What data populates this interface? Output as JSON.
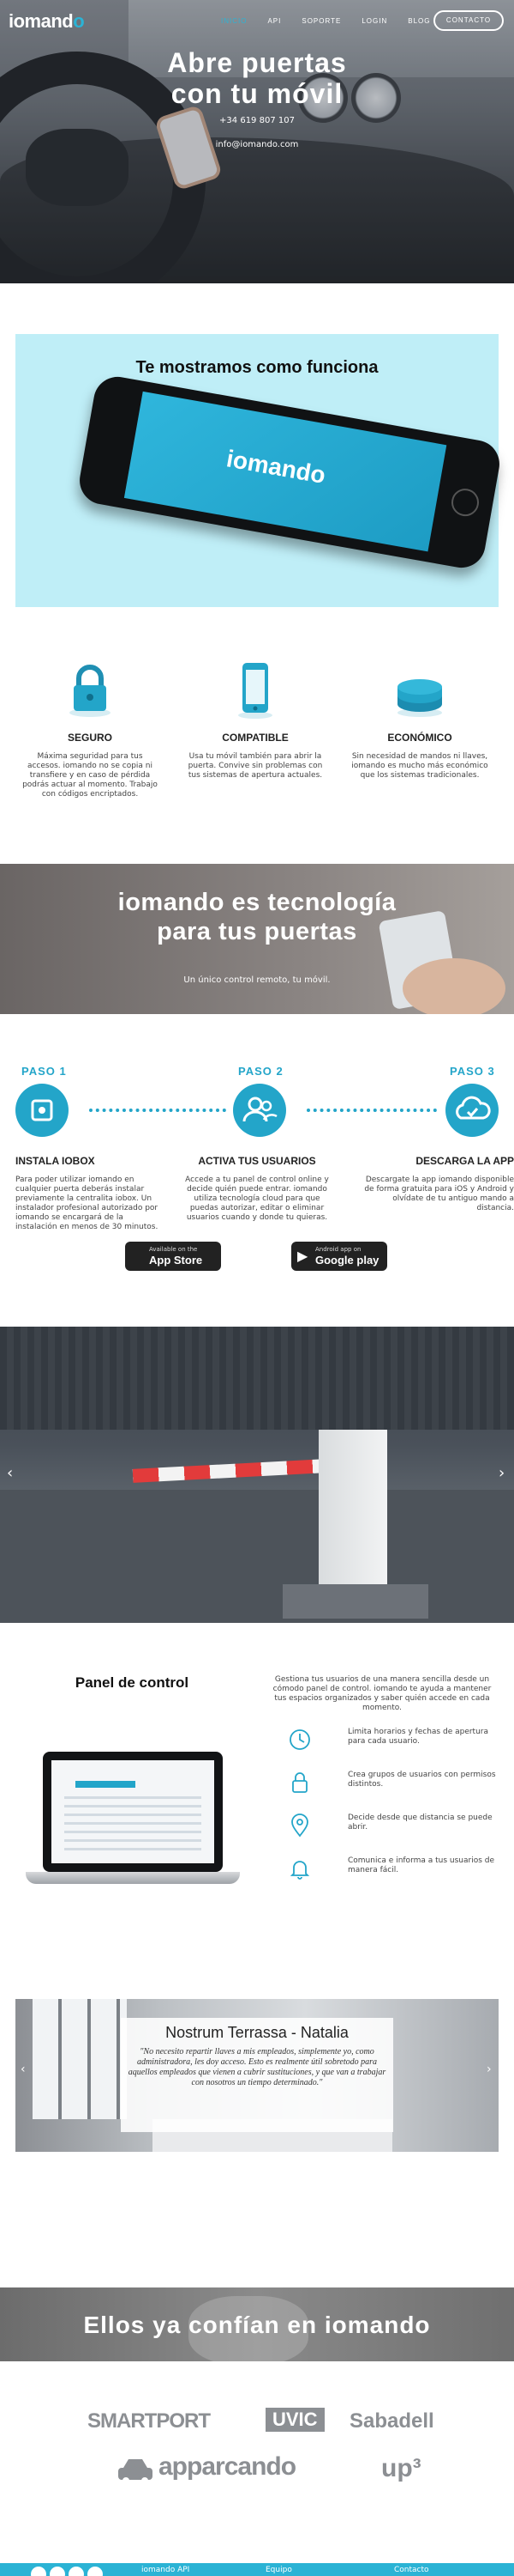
{
  "header": {
    "logo_text": "iomand",
    "logo_accent": "o",
    "nav": [
      "INICIO",
      "API",
      "SOPORTE",
      "LOGIN",
      "BLOG"
    ],
    "contact_button": "CONTACTO"
  },
  "hero": {
    "title_line1": "Abre puertas",
    "title_line2": "con tu móvil",
    "phone": "+34 619 807 107",
    "email": "info@iomando.com"
  },
  "demo": {
    "title": "Te mostramos como funciona",
    "screen_logo": "iomando"
  },
  "features": [
    {
      "title": "SEGURO",
      "text": "Máxima seguridad para tus accesos. iomando no se copia ni transfiere y en caso de pérdida podrás actuar al momento. Trabajo con códigos encriptados.",
      "icon": "padlock-icon"
    },
    {
      "title": "COMPATIBLE",
      "text": "Usa tu móvil también para abrir la puerta. Convive sin problemas con tus sistemas de apertura actuales.",
      "icon": "smartphone-icon"
    },
    {
      "title": "ECONÓMICO",
      "text": "Sin necesidad de mandos ni llaves, iomando es mucho más económico que los sistemas tradicionales.",
      "icon": "coins-icon"
    }
  ],
  "tech": {
    "title_line1": "iomando es tecnología",
    "title_line2": "para tus puertas",
    "subtitle": "Un único control remoto, tu móvil."
  },
  "steps": [
    {
      "label": "PASO 1",
      "title": "INSTALA IOBOX",
      "text": "Para poder utilizar iomando en cualquier puerta deberás instalar previamente la centralita iobox. Un instalador profesional autorizado por iomando se encargará de la instalación en menos de 30 minutos.",
      "icon": "box-icon"
    },
    {
      "label": "PASO 2",
      "title": "ACTIVA TUS USUARIOS",
      "text": "Accede a tu panel de control online y decide quién puede entrar. iomando utiliza tecnología cloud para que puedas autorizar, editar o eliminar usuarios cuando y donde tu quieras.",
      "icon": "users-icon"
    },
    {
      "label": "PASO 3",
      "title": "DESCARGA LA APP",
      "text": "Descargate la app iomando disponible de forma gratuita para iOS y Android y olvídate de tu antiguo mando a distancia.",
      "icon": "cloud-icon"
    }
  ],
  "stores": {
    "apple_small": "Available on the",
    "apple_big": "App Store",
    "google_small": "Android app on",
    "google_big": "Google play"
  },
  "control_panel": {
    "title": "Panel de control",
    "intro": "Gestiona tus usuarios de una manera sencilla desde un cómodo panel de control. iomando te ayuda a mantener tus espacios organizados y saber quién accede en cada momento.",
    "items": [
      {
        "text": "Limita horarios y fechas de apertura para cada usuario.",
        "icon": "clock-icon"
      },
      {
        "text": "Crea grupos de usuarios con permisos distintos.",
        "icon": "lock-icon"
      },
      {
        "text": "Decide desde que distancia se puede abrir.",
        "icon": "location-pin-icon"
      },
      {
        "text": "Comunica e informa a tus usuarios de manera fácil.",
        "icon": "bell-icon"
      }
    ]
  },
  "testimonial": {
    "name": "Nostrum Terrassa - Natalia",
    "quote": "\"No necesito repartir llaves a mis empleados, simplemente yo, como administradora, les doy acceso. Esto es realmente útil sobretodo para aquellos empleados que vienen a cubrir sustituciones, y que van a trabajar con nosotros un tiempo determinado.\""
  },
  "trust": {
    "title": "Ellos ya confían en iomando"
  },
  "partners": [
    "SMARTPORT",
    "UVIC",
    "Sabadell",
    "apparcando",
    "up³"
  ],
  "footer": {
    "links": [
      "iomando API",
      "Equipo",
      "Contacto"
    ]
  },
  "colors": {
    "accent": "#2bb3d5",
    "demo_bg": "#bfeef7",
    "logo_grey": "#8c8f93"
  }
}
